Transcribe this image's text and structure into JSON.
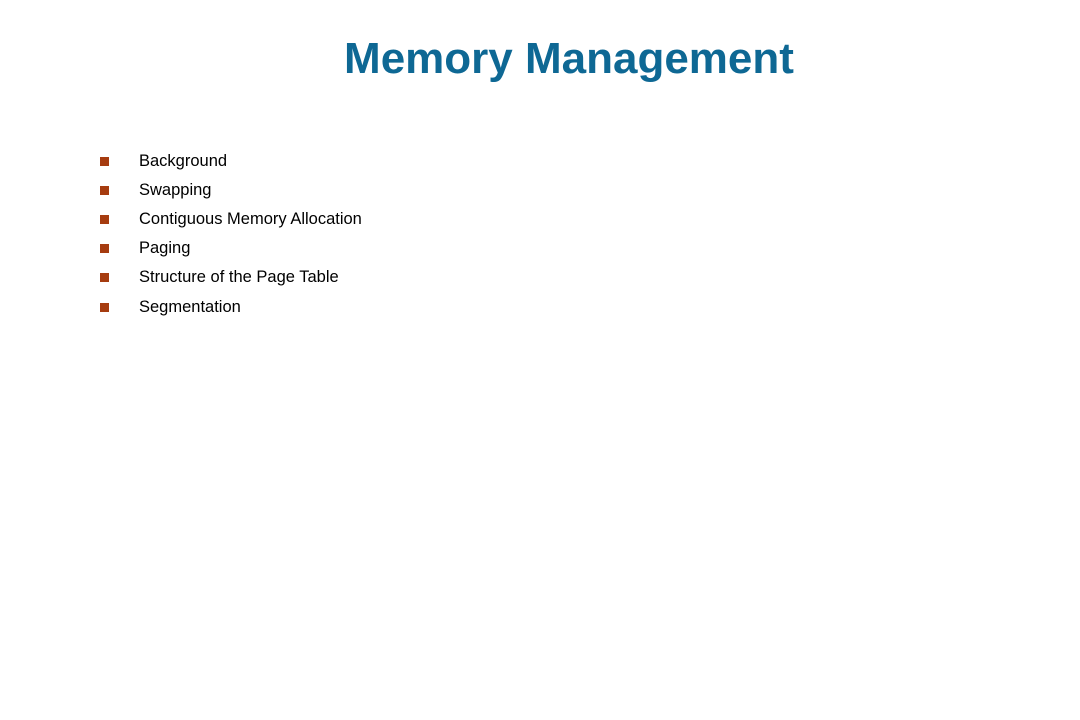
{
  "slide": {
    "title": "Memory Management",
    "colors": {
      "title": "#0e6894",
      "bullet": "#a63c10",
      "text": "#000000"
    },
    "bullets": [
      {
        "icon": "square-bullet-icon",
        "text": "Background"
      },
      {
        "icon": "square-bullet-icon",
        "text": "Swapping"
      },
      {
        "icon": "square-bullet-icon",
        "text": "Contiguous Memory Allocation"
      },
      {
        "icon": "square-bullet-icon",
        "text": "Paging"
      },
      {
        "icon": "square-bullet-icon",
        "text": "Structure of the Page Table"
      },
      {
        "icon": "square-bullet-icon",
        "text": "Segmentation"
      }
    ]
  }
}
